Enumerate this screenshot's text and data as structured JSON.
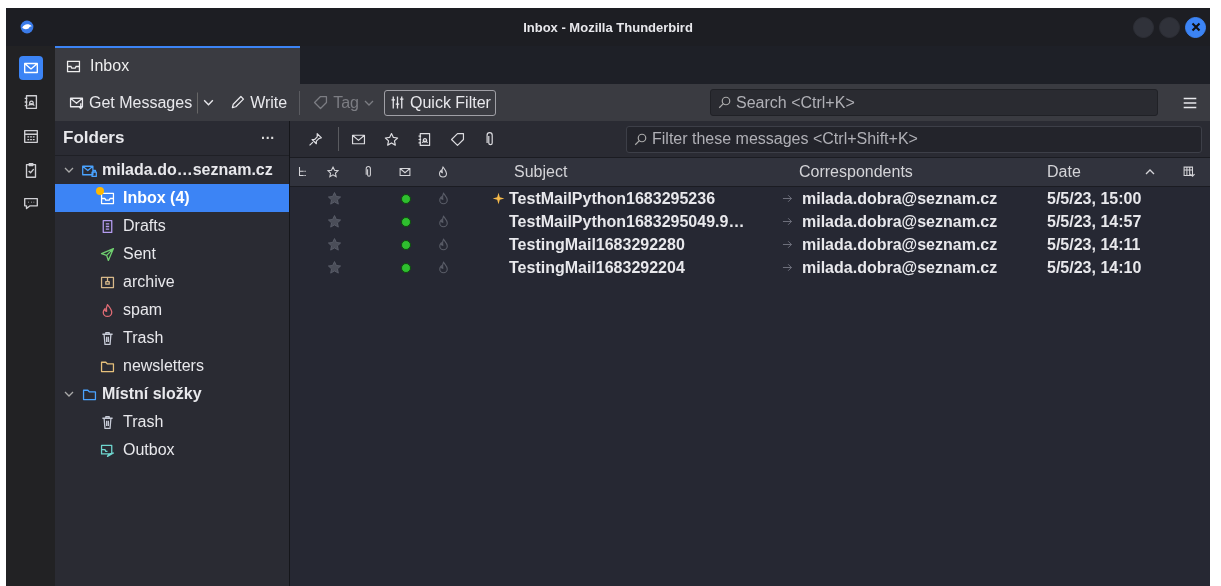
{
  "window": {
    "title": "Inbox - Mozilla Thunderbird"
  },
  "spaces": [
    {
      "kind": "mail",
      "selected": true
    },
    {
      "kind": "contacts",
      "selected": false
    },
    {
      "kind": "calendar",
      "selected": false
    },
    {
      "kind": "tasks",
      "selected": false
    },
    {
      "kind": "chat",
      "selected": false
    }
  ],
  "tabs": [
    {
      "label": "Inbox",
      "selected": true
    }
  ],
  "toolbar": {
    "buttons": [
      {
        "kind": "get",
        "label": "Get Messages",
        "disabled": false
      },
      {
        "kind": "write",
        "label": "Write",
        "disabled": false
      },
      {
        "kind": "tag",
        "label": "Tag",
        "disabled": true
      },
      {
        "kind": "filter",
        "label": "Quick Filter",
        "disabled": false
      }
    ],
    "search": {
      "placeholder": "Search <Ctrl+K>"
    }
  },
  "folders": {
    "title": "Folders",
    "menu": "···",
    "accounts": [
      {
        "name": "milada.do…seznam.cz",
        "kind": "mail",
        "expanded": true,
        "children": [
          {
            "name": "Inbox (4)",
            "kind": "inbox",
            "selected": true,
            "unread": true,
            "new": true
          },
          {
            "name": "Drafts",
            "kind": "drafts",
            "selected": false,
            "unread": false,
            "new": false
          },
          {
            "name": "Sent",
            "kind": "sent",
            "selected": false,
            "unread": false,
            "new": false
          },
          {
            "name": "archive",
            "kind": "archive",
            "selected": false,
            "unread": false,
            "new": false
          },
          {
            "name": "spam",
            "kind": "spam",
            "selected": false,
            "unread": false,
            "new": false
          },
          {
            "name": "Trash",
            "kind": "trash",
            "selected": false,
            "unread": false,
            "new": false
          },
          {
            "name": "newsletters",
            "kind": "folder",
            "selected": false,
            "unread": false,
            "new": false
          }
        ]
      },
      {
        "name": "Místní složky",
        "kind": "local",
        "expanded": true,
        "children": [
          {
            "name": "Trash",
            "kind": "trash",
            "selected": false,
            "unread": false,
            "new": false
          },
          {
            "name": "Outbox",
            "kind": "outbox",
            "selected": false,
            "unread": false,
            "new": false
          }
        ]
      }
    ]
  },
  "quick_filter": {
    "toggles": [
      {
        "kind": "pin"
      },
      {
        "kind": "unread"
      },
      {
        "kind": "starred"
      },
      {
        "kind": "contact"
      },
      {
        "kind": "tag"
      },
      {
        "kind": "attachment"
      }
    ],
    "placeholder": "Filter these messages <Ctrl+Shift+K>"
  },
  "table": {
    "columns": [
      "Subject",
      "Correspondents",
      "Date"
    ],
    "rows": [
      {
        "subject": "TestMailPython1683295236",
        "correspondent": "milada.dobra@seznam.cz",
        "date": "5/5/23, 15:00",
        "starred": false,
        "unread": true,
        "new": true
      },
      {
        "subject": "TestMailPython1683295049.9…",
        "correspondent": "milada.dobra@seznam.cz",
        "date": "5/5/23, 14:57",
        "starred": false,
        "unread": true,
        "new": false
      },
      {
        "subject": "TestingMail1683292280",
        "correspondent": "milada.dobra@seznam.cz",
        "date": "5/5/23, 14:11",
        "starred": false,
        "unread": true,
        "new": false
      },
      {
        "subject": "TestingMail1683292204",
        "correspondent": "milada.dobra@seznam.cz",
        "date": "5/5/23, 14:10",
        "starred": false,
        "unread": true,
        "new": false
      }
    ]
  }
}
